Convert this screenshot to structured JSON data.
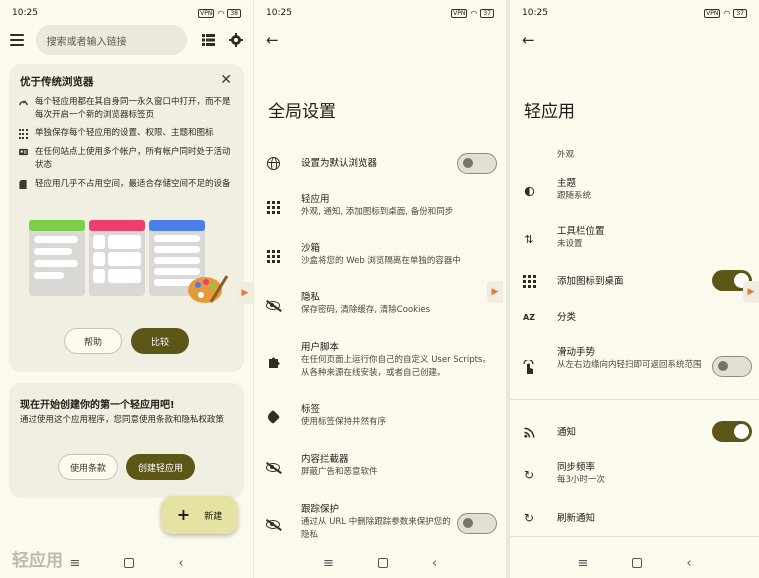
{
  "status": {
    "time": "10:25",
    "vpn": "VPN",
    "battery_p1": "38",
    "battery_p2": "37",
    "battery_p3": "37"
  },
  "panel1": {
    "search_placeholder": "搜索或者输入链接",
    "card1": {
      "title": "优于传统浏览器",
      "features": [
        {
          "icon": "speed-icon",
          "text": "每个轻应用都在其自身同一永久窗口中打开，而不是每次开启一个新的浏览器标签页"
        },
        {
          "icon": "apps-grid-icon",
          "text": "单独保存每个轻应用的设置、权限、主题和图标"
        },
        {
          "icon": "accounts-icon",
          "text": "在任何站点上使用多个帐户，所有帐户同时处于活动状态"
        },
        {
          "icon": "storage-icon",
          "text": "轻应用几乎不占用空间，最适合存储空间不足的设备"
        }
      ],
      "help_label": "帮助",
      "compare_label": "比较"
    },
    "card2": {
      "title": "现在开始创建你的第一个轻应用吧!",
      "desc": "通过使用这个应用程序，您同意使用条款和隐私权政策",
      "terms_label": "使用条款",
      "create_label": "创建轻应用"
    },
    "fab_label": "新建",
    "ghost_title": "轻应用"
  },
  "panel2": {
    "title": "全局设置",
    "rows": [
      {
        "icon": "globe-icon",
        "title": "设置为默认浏览器",
        "sub": ""
      },
      {
        "icon": "apps-grid-icon",
        "title": "轻应用",
        "sub": "外观, 通知, 添加图标到桌面, 备份和同步"
      },
      {
        "icon": "apps-grid-icon",
        "title": "沙箱",
        "sub": "沙盒将您的 Web 浏览隔离在单独的容器中"
      },
      {
        "icon": "eye-off-icon",
        "title": "隐私",
        "sub": "保存密码, 清除缓存, 清除Cookies"
      },
      {
        "icon": "puzzle-icon",
        "title": "用户脚本",
        "sub": "在任何页面上运行你自己的自定义 User Scripts。从各种来源在线安装，或者自己创建。"
      },
      {
        "icon": "tag-icon",
        "title": "标签",
        "sub": "使用标签保持井然有序"
      },
      {
        "icon": "eye-off-icon",
        "title": "内容拦截器",
        "sub": "屏蔽广告和恶意软件"
      },
      {
        "icon": "eye-off-icon",
        "title": "跟踪保护",
        "sub": "通过从 URL 中删除跟踪参数来保护您的隐私"
      }
    ]
  },
  "panel3": {
    "title": "轻应用",
    "section": "外观",
    "rows": [
      {
        "icon": "theme-icon",
        "title": "主题",
        "sub": "跟随系统"
      },
      {
        "icon": "toolbar-position-icon",
        "title": "工具栏位置",
        "sub": "未设置"
      },
      {
        "icon": "apps-grid-icon",
        "title": "添加图标到桌面",
        "sub": ""
      },
      {
        "icon": "sort-az-icon",
        "title": "分类",
        "sub": ""
      },
      {
        "icon": "swipe-gesture-icon",
        "title": "滑动手势",
        "sub": "从左右边缘向内轻扫即可返回系统范围"
      },
      {
        "icon": "rss-icon",
        "title": "通知",
        "sub": ""
      },
      {
        "icon": "sync-icon",
        "title": "同步频率",
        "sub": "每3小时一次"
      },
      {
        "icon": "refresh-icon",
        "title": "刷新通知",
        "sub": ""
      }
    ]
  },
  "colors": {
    "accent": "#5c5717",
    "background": "#fcf9ed",
    "card": "#f1efe1",
    "fab": "#e6e2a2"
  }
}
